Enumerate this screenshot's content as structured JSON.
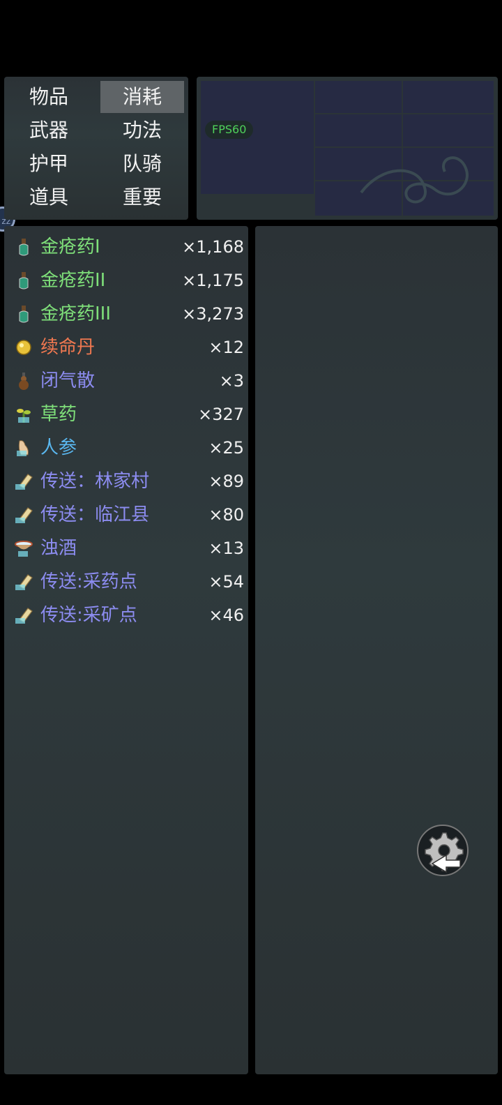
{
  "categories": [
    {
      "label": "物品",
      "selected": false
    },
    {
      "label": "消耗",
      "selected": true
    },
    {
      "label": "武器",
      "selected": false
    },
    {
      "label": "功法",
      "selected": false
    },
    {
      "label": "护甲",
      "selected": false
    },
    {
      "label": "队骑",
      "selected": false
    },
    {
      "label": "道具",
      "selected": false
    },
    {
      "label": "重要",
      "selected": false
    }
  ],
  "fps_label": "FPS60",
  "badge": "zz",
  "items": [
    {
      "name": "金疮药I",
      "count": "×1,168",
      "color": "#7fe07a",
      "icon": "potion-bottle-icon"
    },
    {
      "name": "金疮药II",
      "count": "×1,175",
      "color": "#7fe07a",
      "icon": "potion-bottle-icon"
    },
    {
      "name": "金疮药III",
      "count": "×3,273",
      "color": "#7fe07a",
      "icon": "potion-bottle-icon"
    },
    {
      "name": "续命丹",
      "count": "×12",
      "color": "#f07850",
      "icon": "gold-pill-icon"
    },
    {
      "name": "闭气散",
      "count": "×3",
      "color": "#8c8cf0",
      "icon": "gourd-icon"
    },
    {
      "name": "草药",
      "count": "×327",
      "color": "#7fe07a",
      "icon": "herb-icon"
    },
    {
      "name": "人参",
      "count": "×25",
      "color": "#5ab8f0",
      "icon": "ginseng-icon"
    },
    {
      "name": "传送：林家村",
      "count": "×89",
      "color": "#8c8cf0",
      "icon": "scroll-icon"
    },
    {
      "name": "传送：临江县",
      "count": "×80",
      "color": "#8c8cf0",
      "icon": "scroll-icon"
    },
    {
      "name": "浊酒",
      "count": "×13",
      "color": "#8c8cf0",
      "icon": "wine-bowl-icon"
    },
    {
      "name": "传送:采药点",
      "count": "×54",
      "color": "#8c8cf0",
      "icon": "scroll-icon"
    },
    {
      "name": "传送:采矿点",
      "count": "×46",
      "color": "#8c8cf0",
      "icon": "scroll-icon"
    }
  ]
}
